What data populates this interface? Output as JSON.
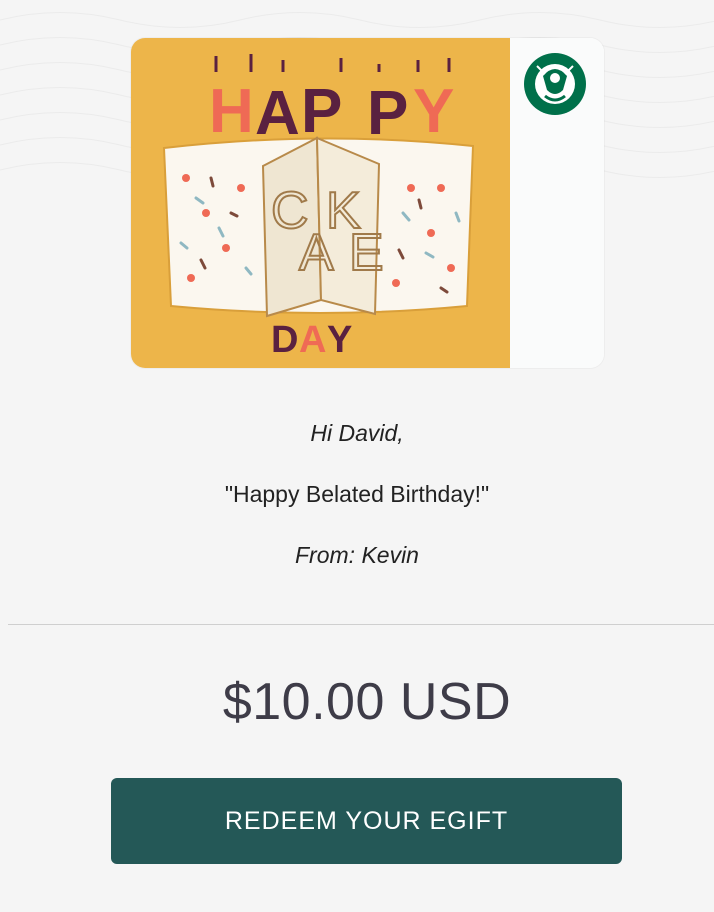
{
  "card": {
    "art_words": [
      "HAPPY",
      "CAKE",
      "DAY"
    ],
    "brand_logo": "starbucks-siren-logo",
    "colors": {
      "background": "#edb54a",
      "coral": "#ef6a55",
      "plum": "#5a2140",
      "cake": "#fbf7ef",
      "strip": "#fafbfb",
      "logo_green": "#00704a"
    }
  },
  "message": {
    "greeting": "Hi David,",
    "note": "\"Happy Belated Birthday!\"",
    "from": "From: Kevin"
  },
  "amount": "$10.00 USD",
  "redeem_button": {
    "label": "REDEEM YOUR EGIFT",
    "color": "#245857"
  }
}
